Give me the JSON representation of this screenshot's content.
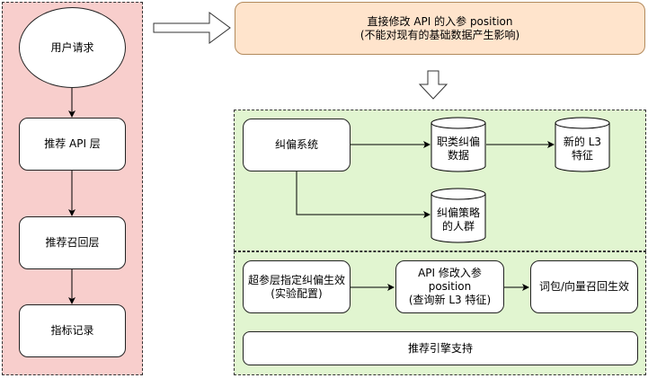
{
  "left_flow": {
    "user_request": "用户请求",
    "rec_api_layer": "推荐 API 层",
    "rec_recall_layer": "推荐召回层",
    "metric_record": "指标记录"
  },
  "top_note": "直接修改 API 的入参 position\n(不能对现有的基础数据产生影响)",
  "correction": {
    "system": "纠偏系统",
    "occupation_data": "职类纠偏\n数据",
    "new_l3": "新的 L3\n特征",
    "strategy_crowd": "纠偏策略\n的人群"
  },
  "pipeline": {
    "hyper_layer": "超参层指定纠偏生效\n(实验配置)",
    "api_modify": "API 修改入参\nposition\n(查询新 L3 特征)",
    "recall_effect": "词包/向量召回生效",
    "engine_support": "推荐引擎支持"
  },
  "colors": {
    "left_panel": "#f8cecc",
    "right_panel": "#e1f5d0",
    "note_box": "#ffe4cc"
  }
}
